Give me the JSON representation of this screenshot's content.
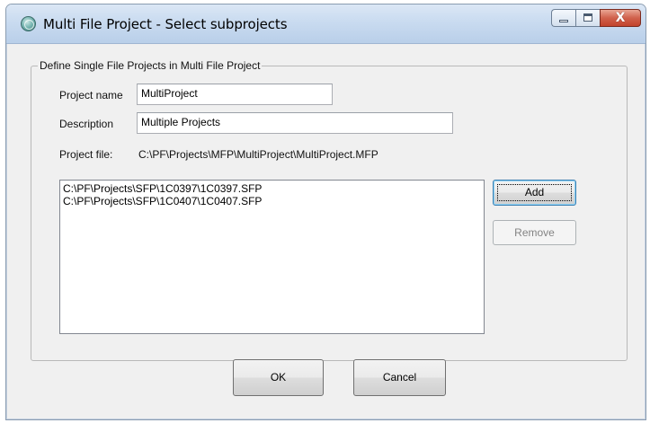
{
  "window": {
    "title": "Multi File Project - Select subprojects",
    "icon": "app-globe-icon",
    "controls": {
      "minimize": "minimize-icon",
      "maximize": "maximize-icon",
      "close_glyph": "X"
    }
  },
  "group": {
    "legend": "Define Single File Projects in Multi File Project"
  },
  "fields": {
    "project_name_label": "Project name",
    "project_name_value": "MultiProject",
    "description_label": "Description",
    "description_value": "Multiple Projects",
    "project_file_label": "Project file:",
    "project_file_value": "C:\\PF\\Projects\\MFP\\MultiProject\\MultiProject.MFP"
  },
  "subprojects": [
    "C:\\PF\\Projects\\SFP\\1C0397\\1C0397.SFP",
    "C:\\PF\\Projects\\SFP\\1C0407\\1C0407.SFP"
  ],
  "buttons": {
    "add": "Add",
    "remove": "Remove",
    "ok": "OK",
    "cancel": "Cancel"
  }
}
